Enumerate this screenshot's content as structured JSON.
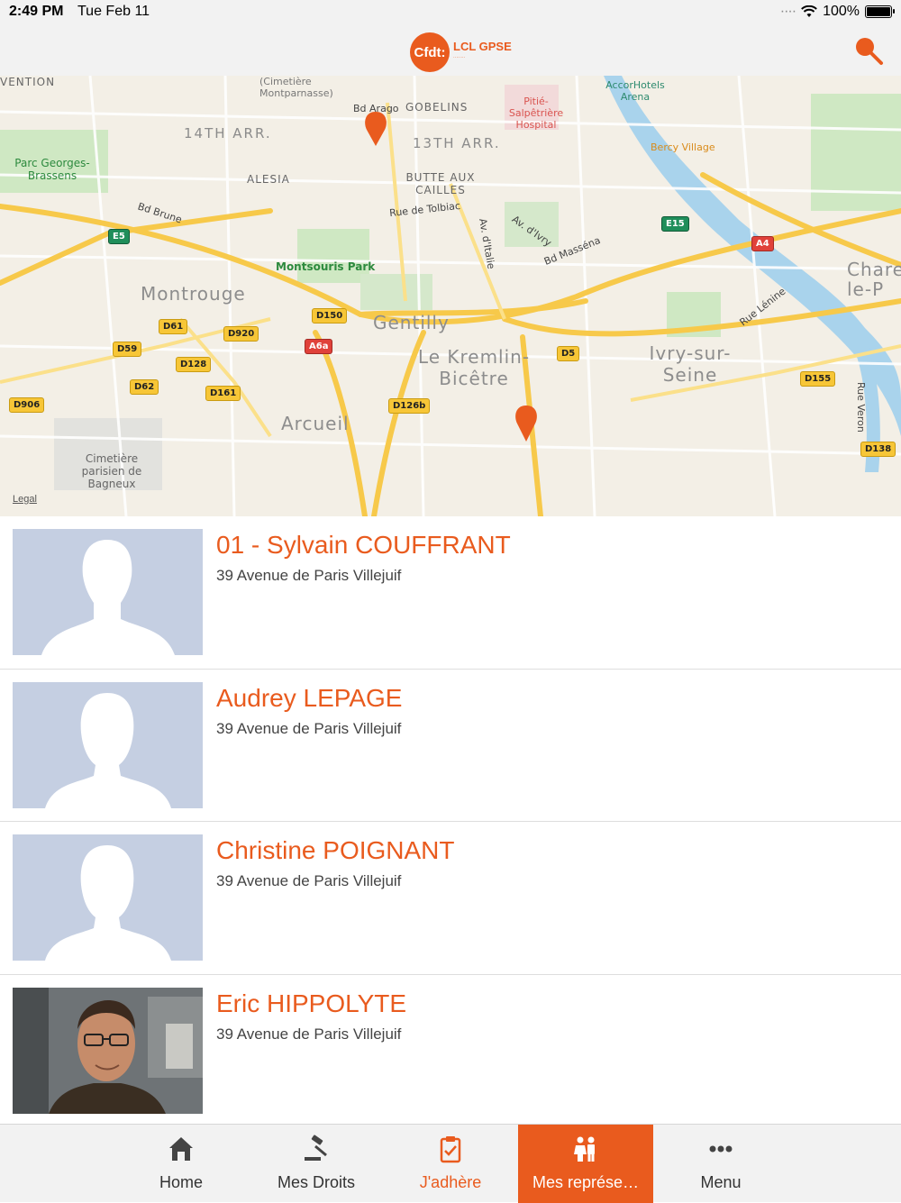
{
  "status_bar": {
    "time": "2:49 PM",
    "date": "Tue Feb 11",
    "battery": "100%",
    "battery_level": 1.0
  },
  "header": {
    "logo_main": "Cfdt:",
    "logo_text": "LCL GPSE",
    "search_icon": "search-icon"
  },
  "map": {
    "labels": {
      "cemetery_mont": "(Cimetière Montparnasse)",
      "vention": "VENTION",
      "arago": "Bd Arago",
      "gobelins": "GOBELINS",
      "pitie": "Pitié-Salpêtrière Hospital",
      "accor": "AccorHotels Arena",
      "arr14": "14TH ARR.",
      "arr13": "13TH ARR.",
      "bercy": "Bercy Village",
      "parc": "Parc Georges-Brassens",
      "alesia": "ALESIA",
      "butte": "BUTTE AUX CAILLES",
      "tolbiac": "Rue de Tolbiac",
      "brune": "Bd Brune",
      "italie": "Av. d'Italie",
      "ivry_av": "Av. d'Ivry",
      "massena": "Bd Masséna",
      "montsouris": "Montsouris Park",
      "montrouge": "Montrouge",
      "gentilly": "Gentilly",
      "kremlin": "Le Kremlin-Bicêtre",
      "ivry": "Ivry-sur-Seine",
      "charenton": "Charenton-le-P",
      "lenine": "Rue Lénine",
      "arcueil": "Arcueil",
      "cimetiere_bagneux": "Cimetière parisien de Bagneux",
      "veron": "Rue Veron",
      "legal": "Legal"
    },
    "roads": [
      "E5",
      "E15",
      "A4",
      "D150",
      "D61",
      "D920",
      "D59",
      "A6a",
      "D128",
      "D62",
      "D161",
      "D906",
      "D5",
      "D126b",
      "D155",
      "D138"
    ]
  },
  "representatives": [
    {
      "name": "01 - Sylvain COUFFRANT",
      "address": "39 Avenue de Paris Villejuif",
      "photo": "male-silhouette"
    },
    {
      "name": "Audrey LEPAGE",
      "address": "39 Avenue de Paris Villejuif",
      "photo": "female-silhouette"
    },
    {
      "name": "Christine POIGNANT",
      "address": "39 Avenue de Paris Villejuif",
      "photo": "female-silhouette"
    },
    {
      "name": "Eric HIPPOLYTE",
      "address": "39 Avenue de Paris Villejuif",
      "photo": "portrait-photo"
    }
  ],
  "tabs": [
    {
      "label": "Home",
      "icon": "home-icon"
    },
    {
      "label": "Mes Droits",
      "icon": "gavel-icon"
    },
    {
      "label": "J'adhère",
      "icon": "clipboard-check-icon"
    },
    {
      "label": "Mes représe…",
      "icon": "people-icon",
      "active": true
    },
    {
      "label": "Menu",
      "icon": "more-icon"
    }
  ],
  "colors": {
    "accent": "#e95b1e",
    "photo_placeholder": "#c5cfe2"
  }
}
